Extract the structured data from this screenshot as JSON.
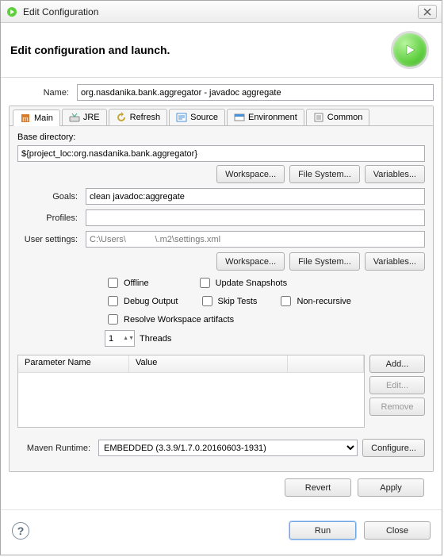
{
  "window": {
    "title": "Edit Configuration"
  },
  "header": {
    "title": "Edit configuration and launch."
  },
  "name": {
    "label": "Name:",
    "value": "org.nasdanika.bank.aggregator - javadoc aggregate"
  },
  "tabs": {
    "main": "Main",
    "jre": "JRE",
    "refresh": "Refresh",
    "source": "Source",
    "environment": "Environment",
    "common": "Common"
  },
  "main": {
    "baseDirLabel": "Base directory:",
    "baseDir": "${project_loc:org.nasdanika.bank.aggregator}",
    "workspaceBtn": "Workspace...",
    "fileSystemBtn": "File System...",
    "variablesBtn": "Variables...",
    "goalsLabel": "Goals:",
    "goals": "clean javadoc:aggregate",
    "profilesLabel": "Profiles:",
    "profiles": "",
    "userSettingsLabel": "User settings:",
    "userSettings": "C:\\Users\\            \\.m2\\settings.xml",
    "chkOffline": "Offline",
    "chkUpdate": "Update Snapshots",
    "chkDebug": "Debug Output",
    "chkSkip": "Skip Tests",
    "chkNonrec": "Non-recursive",
    "chkResolve": "Resolve Workspace artifacts",
    "threads": "1",
    "threadsLabel": "Threads",
    "paramName": "Parameter Name",
    "paramValue": "Value",
    "addBtn": "Add...",
    "editBtn": "Edit...",
    "removeBtn": "Remove",
    "mavenRuntimeLabel": "Maven Runtime:",
    "mavenRuntime": "EMBEDDED (3.3.9/1.7.0.20160603-1931)",
    "configureBtn": "Configure..."
  },
  "footer": {
    "revert": "Revert",
    "apply": "Apply",
    "run": "Run",
    "close": "Close"
  }
}
